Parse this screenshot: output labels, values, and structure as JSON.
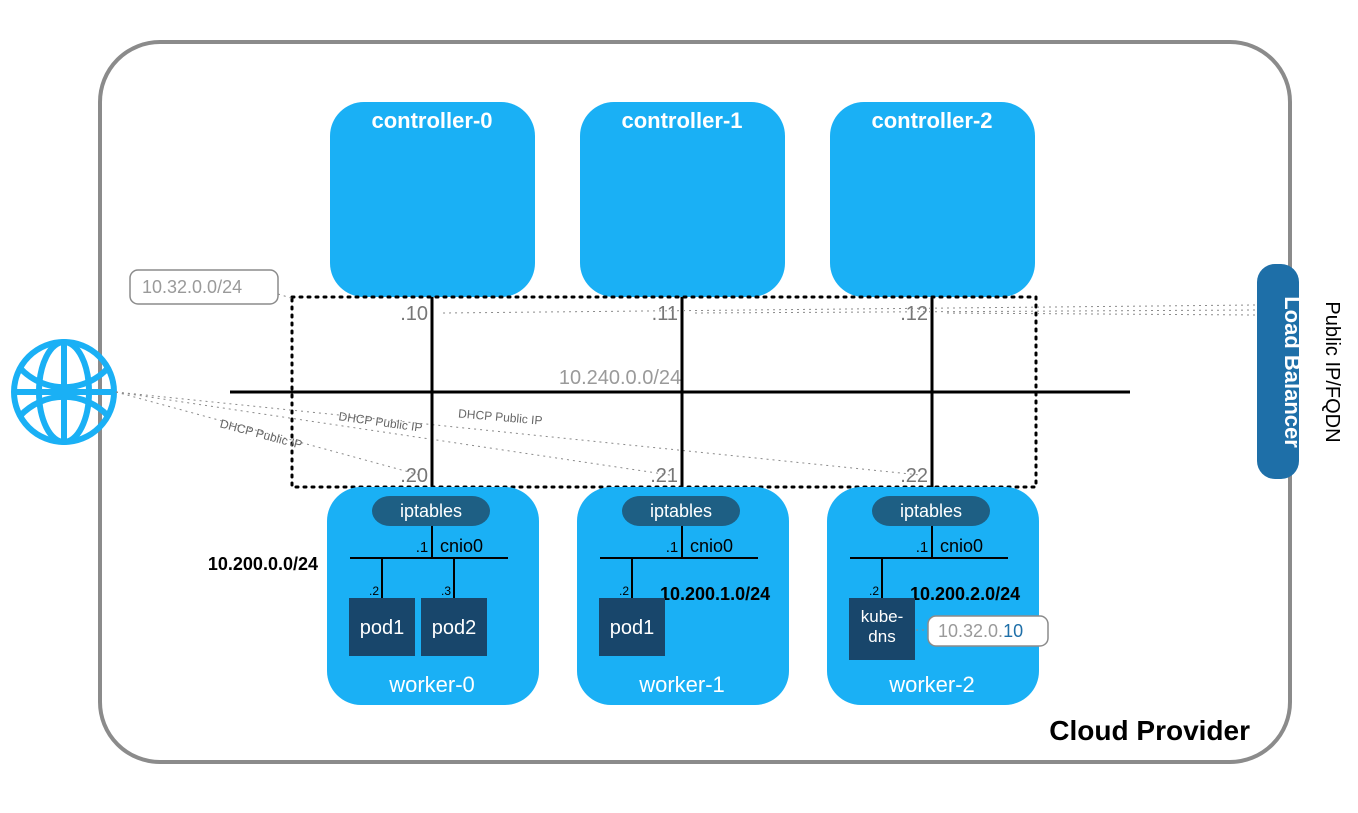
{
  "cloud_label": "Cloud Provider",
  "public_label": "Public IP/FQDN",
  "load_balancer": "Load Balancer",
  "bus_subnet": "10.240.0.0/24",
  "service_subnet": "10.32.0.0/24",
  "controllers": [
    {
      "name": "controller-0",
      "ip": ".10"
    },
    {
      "name": "controller-1",
      "ip": ".11"
    },
    {
      "name": "controller-2",
      "ip": ".12"
    }
  ],
  "workers": [
    {
      "name": "worker-0",
      "ip": ".20",
      "iptables": "iptables",
      "cnio": {
        "ip": ".1",
        "if": "cnio0"
      },
      "pod_cidr": "10.200.0.0/24",
      "pods": [
        {
          "name": "pod1",
          "ip": ".2"
        },
        {
          "name": "pod2",
          "ip": ".3"
        }
      ]
    },
    {
      "name": "worker-1",
      "ip": ".21",
      "iptables": "iptables",
      "cnio": {
        "ip": ".1",
        "if": "cnio0"
      },
      "pod_cidr": "10.200.1.0/24",
      "pods": [
        {
          "name": "pod1",
          "ip": ".2"
        }
      ]
    },
    {
      "name": "worker-2",
      "ip": ".22",
      "iptables": "iptables",
      "cnio": {
        "ip": ".1",
        "if": "cnio0"
      },
      "pod_cidr": "10.200.2.0/24",
      "pods": [
        {
          "name": "kube-dns",
          "ip": ".2"
        }
      ]
    }
  ],
  "dhcp_label": "DHCP Public IP",
  "kubedns_service_ip": "10.32.0.10"
}
